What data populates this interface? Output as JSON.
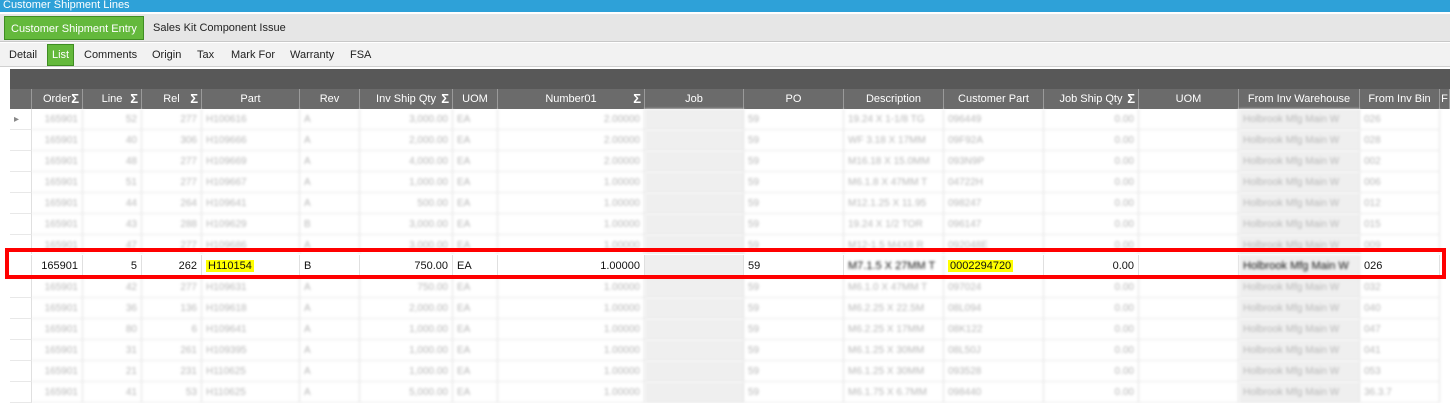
{
  "window": {
    "title": "Customer Shipment Lines"
  },
  "tabs": [
    {
      "label": "Customer Shipment Entry",
      "active": true
    },
    {
      "label": "Sales Kit Component Issue",
      "active": false
    }
  ],
  "subtabs": [
    "Detail",
    "List",
    "Comments",
    "Origin",
    "Tax",
    "Mark For",
    "Warranty",
    "FSA"
  ],
  "grid": {
    "columns": [
      "Order",
      "Line",
      "Rel",
      "Part",
      "Rev",
      "Inv Ship Qty",
      "UOM",
      "Number01",
      "Job",
      "PO",
      "Description",
      "Customer Part",
      "Job Ship Qty",
      "UOM",
      "From Inv Warehouse",
      "From Inv Bin",
      "F"
    ],
    "blurred_rows_above": [
      [
        "165901",
        "52",
        "277",
        "H100616",
        "A",
        "3,000.00",
        "EA",
        "2.00000",
        "",
        "59",
        "19.24 X 1-1/8 TG",
        "096449",
        "0.00",
        "",
        "Holbrook Mfg Main W",
        "026"
      ],
      [
        "165901",
        "40",
        "306",
        "H109666",
        "A",
        "2,000.00",
        "EA",
        "2.00000",
        "",
        "59",
        "WF 3.18 X 17MM",
        "09F92A",
        "0.00",
        "",
        "Holbrook Mfg Main W",
        "028"
      ],
      [
        "165901",
        "48",
        "277",
        "H109669",
        "A",
        "4,000.00",
        "EA",
        "2.00000",
        "",
        "59",
        "M16.18 X 15.0MM",
        "093N9P",
        "0.00",
        "",
        "Holbrook Mfg Main W",
        "002"
      ],
      [
        "165901",
        "51",
        "277",
        "H109667",
        "A",
        "1,000.00",
        "EA",
        "1.00000",
        "",
        "59",
        "M6.1.8 X 47MM T",
        "04722H",
        "0.00",
        "",
        "Holbrook Mfg Main W",
        "006"
      ],
      [
        "165901",
        "44",
        "264",
        "H109641",
        "A",
        "500.00",
        "EA",
        "1.00000",
        "",
        "59",
        "M12.1.25 X 11.95",
        "098247",
        "0.00",
        "",
        "Holbrook Mfg Main W",
        "012"
      ],
      [
        "165901",
        "43",
        "288",
        "H109629",
        "B",
        "3,000.00",
        "EA",
        "1.00000",
        "",
        "59",
        "19.24 X 1/2 TOR",
        "096147",
        "0.00",
        "",
        "Holbrook Mfg Main W",
        "015"
      ],
      [
        "165901",
        "47",
        "277",
        "H109686",
        "A",
        "3,000.00",
        "EA",
        "1.00000",
        "",
        "59",
        "M12-1.5 M4X8 R",
        "092048E",
        "0.00",
        "",
        "Holbrook Mfg Main W",
        "009"
      ]
    ],
    "focus_row": {
      "order": "165901",
      "line": "5",
      "rel": "262",
      "part": "H110154",
      "rev": "B",
      "inv_ship_qty": "750.00",
      "uom": "EA",
      "number01": "1.00000",
      "job": "",
      "po": "59",
      "description": "M7.1.5 X 27MM T",
      "customer_part": "0002294720",
      "job_ship_qty": "0.00",
      "uom2": "",
      "from_inv_warehouse": "Holbrook Mfg Main W",
      "from_inv_bin": "026"
    },
    "blurred_rows_below": [
      [
        "165901",
        "42",
        "277",
        "H109631",
        "A",
        "750.00",
        "EA",
        "1.00000",
        "",
        "59",
        "M6.1.0 X 47MM T",
        "097024",
        "0.00",
        "",
        "Holbrook Mfg Main W",
        "032"
      ],
      [
        "165901",
        "36",
        "136",
        "H109618",
        "A",
        "2,000.00",
        "EA",
        "1.00000",
        "",
        "59",
        "M6.2.25 X 22.5M",
        "08L094",
        "0.00",
        "",
        "Holbrook Mfg Main W",
        "040"
      ],
      [
        "165901",
        "80",
        "6",
        "H109641",
        "A",
        "1,000.00",
        "EA",
        "1.00000",
        "",
        "59",
        "M6.2.25 X 17MM",
        "08K122",
        "0.00",
        "",
        "Holbrook Mfg Main W",
        "047"
      ],
      [
        "165901",
        "31",
        "261",
        "H109395",
        "A",
        "1,000.00",
        "EA",
        "1.00000",
        "",
        "59",
        "M6.1.25 X 30MM",
        "08L50J",
        "0.00",
        "",
        "Holbrook Mfg Main W",
        "041"
      ],
      [
        "165901",
        "21",
        "231",
        "H110625",
        "A",
        "1,000.00",
        "EA",
        "1.00000",
        "",
        "59",
        "M6.1.25 X 30MM",
        "093528",
        "0.00",
        "",
        "Holbrook Mfg Main W",
        "053"
      ],
      [
        "165901",
        "41",
        "53",
        "H110625",
        "A",
        "5,000.00",
        "EA",
        "1.00000",
        "",
        "59",
        "M6.1.75 X 6.7MM",
        "098440",
        "0.00",
        "",
        "Holbrook Mfg Main W",
        "36.3.7"
      ]
    ]
  },
  "colors": {
    "accent_green": "#64b93c",
    "title_blue": "#2ea1d8",
    "highlight_yellow": "#ffff00",
    "box_red": "#ff0000"
  }
}
